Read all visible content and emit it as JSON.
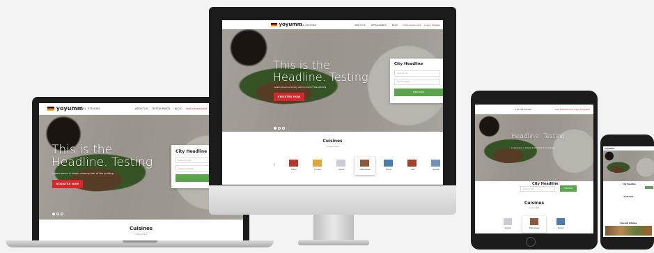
{
  "site": {
    "logo_text": "yoyumm",
    "phone": "+91- 97350365",
    "nav": [
      "ABOUT US",
      "RESTAURANTS",
      "BLOG"
    ],
    "add_restaurant": "Add a Restaurant",
    "login": "Login | Register",
    "hero_title_line1": "This is the",
    "hero_title_line2": "Headline. Testing",
    "hero_sub": "Lorem Ipsum is simply dummy text of the printing",
    "register_button": "REGISTER NOW",
    "card_title": "City Headline",
    "select_city_placeholder": "Select a City",
    "select_locality_placeholder": "Select Locality",
    "find_button": "FIND NOW",
    "cuisines_title": "Cuisines",
    "cuisines_sub": "Cuisine Text",
    "cuisines": [
      "French",
      "Chinese",
      "Yogurts",
      "Vietnamese",
      "Turkish",
      "Thai",
      "Spanish"
    ],
    "recent_dishes": "Recent Dishes",
    "accent_red": "#d7262d",
    "accent_green": "#5aa54c"
  }
}
